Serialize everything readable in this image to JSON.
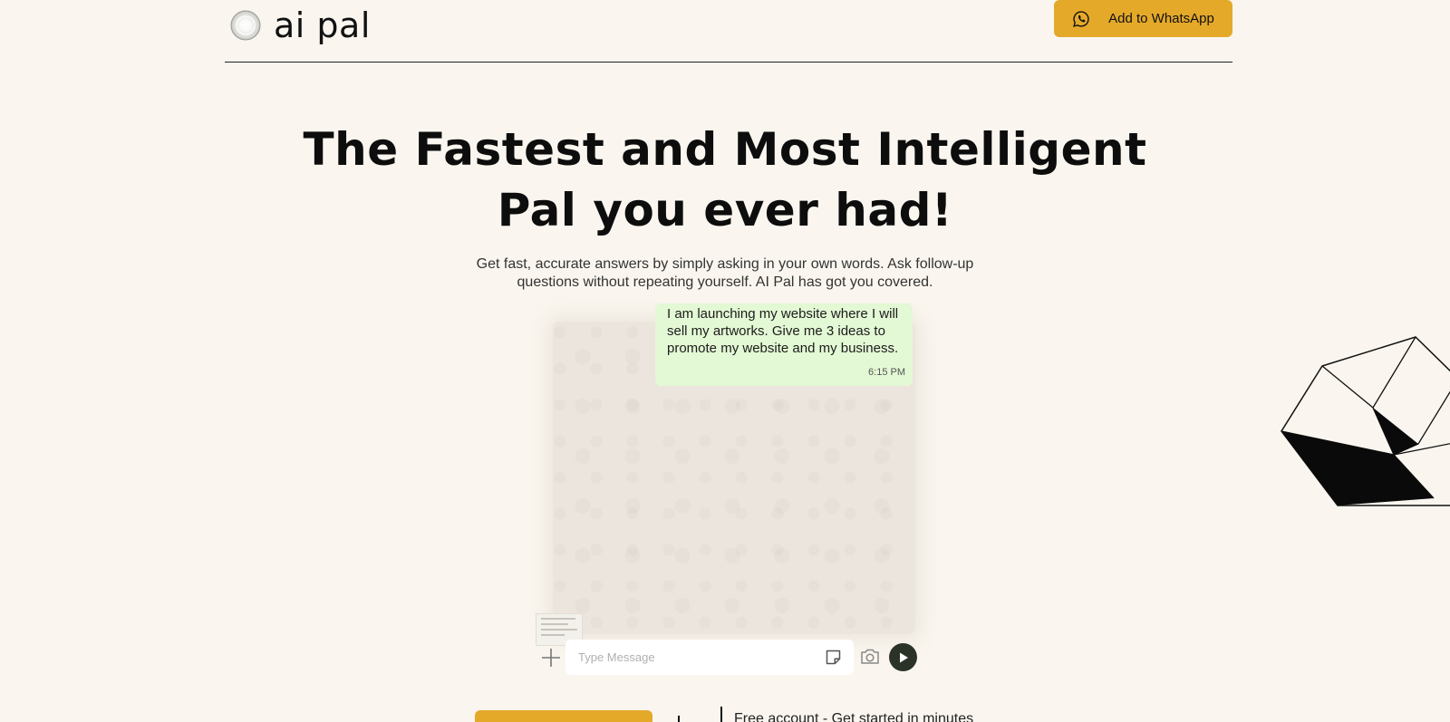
{
  "header": {
    "logo_text": "ai pal",
    "cta_label": "Add to WhatsApp",
    "cta_icon": "whatsapp-icon"
  },
  "hero": {
    "title_line1": "The Fastest and Most Intelligent",
    "title_line2": "Pal you ever had!",
    "subtitle": "Get fast, accurate answers by simply asking in your own words. Ask follow-up questions without repeating yourself. AI Pal has got you covered."
  },
  "chat": {
    "message_text": "I am launching my website where I will sell my artworks. Give me 3 ideas to promote my website and my business.",
    "message_time": "6:15 PM",
    "input_placeholder": "Type Message",
    "icons": [
      "plus-icon",
      "sticker-icon",
      "camera-icon",
      "send-icon"
    ]
  },
  "footer": {
    "free_account_text": "Free account - Get started in minutes"
  },
  "colors": {
    "background": "#faf6ef",
    "accent": "#e5a92a",
    "bubble": "#e3f8d4",
    "send_button": "#2b3328"
  }
}
